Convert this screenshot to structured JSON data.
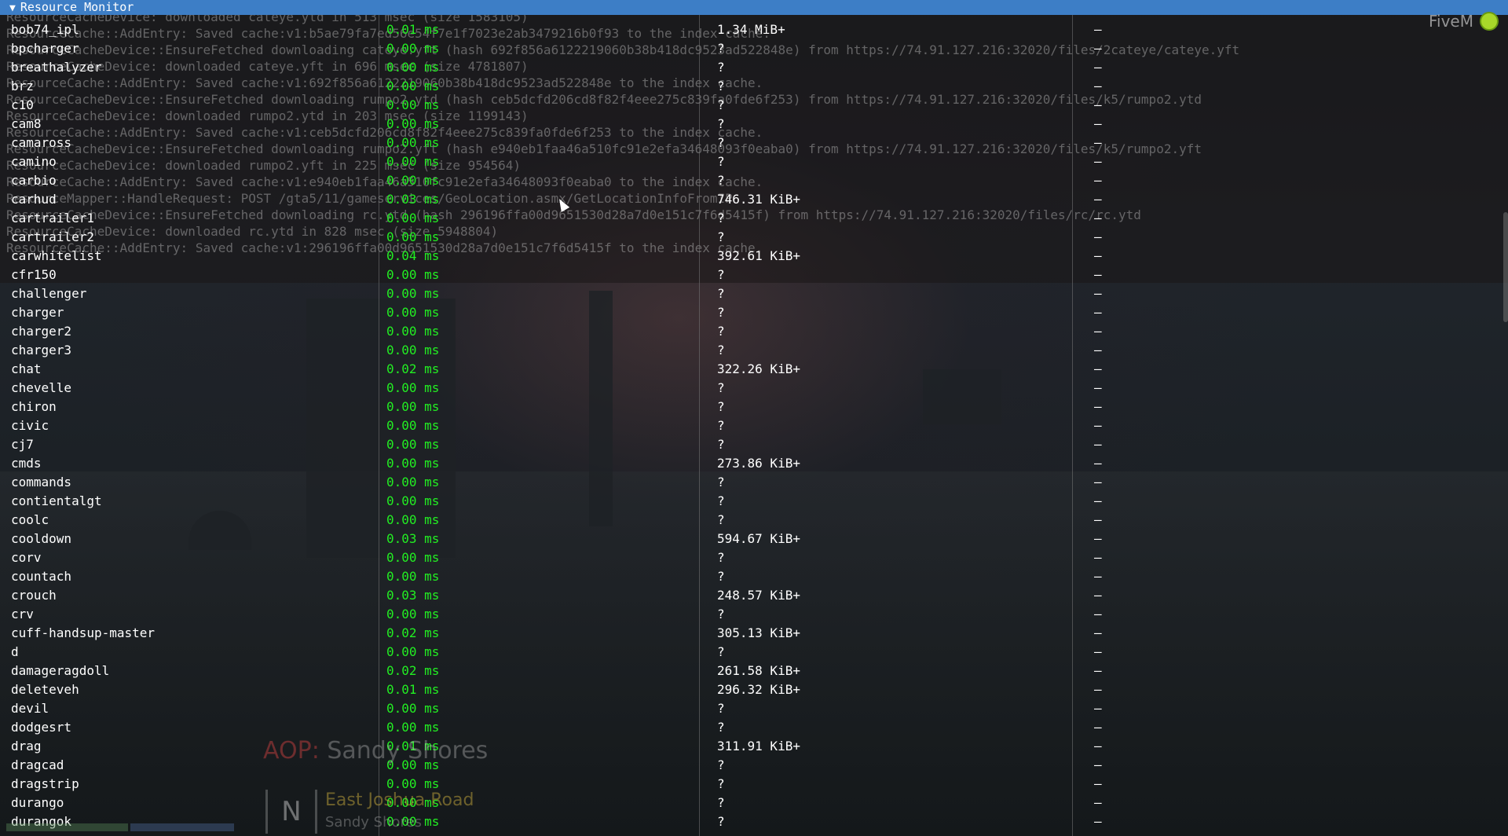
{
  "window": {
    "title": "Resource Monitor",
    "collapse_arrow": "▼"
  },
  "branding": {
    "logo_text": "FiveM",
    "logo_icon": "fivem-logo-icon"
  },
  "console_log": [
    "ResourceCacheDevice: downloaded cateye.ytd in 513 msec (size 1583105)",
    "ResourceCache::AddEntry: Saved cache:v1:b5ae79fa7ed56e54f7e1f7023e2ab3479216b0f93 to the index cache.",
    "ResourceCacheDevice::EnsureFetched downloading cateye.yft (hash 692f856a6122219060b38b418dc9523ad522848e) from https://74.91.127.216:32020/files/2cateye/cateye.yft",
    "ResourceCacheDevice: downloaded cateye.yft in 696 msec (size 4781807)",
    "ResourceCache::AddEntry: Saved cache:v1:692f856a6122219060b38b418dc9523ad522848e to the index cache.",
    "ResourceCacheDevice::EnsureFetched downloading rumpo2.ytd (hash ceb5dcfd206cd8f82f4eee275c839fa0fde6f253) from https://74.91.127.216:32020/files/k5/rumpo2.ytd",
    "ResourceCacheDevice: downloaded rumpo2.ytd in 203 msec (size 1199143)",
    "ResourceCache::AddEntry: Saved cache:v1:ceb5dcfd206cd8f82f4eee275c839fa0fde6f253 to the index cache.",
    "ResourceCacheDevice::EnsureFetched downloading rumpo2.yft (hash e940eb1faa46a510fc91e2efa34648093f0eaba0) from https://74.91.127.216:32020/files/k5/rumpo2.yft",
    "ResourceCacheDevice: downloaded rumpo2.yft in 225 msec (size 954564)",
    "ResourceCache::AddEntry: Saved cache:v1:e940eb1faa46a510fc91e2efa34648093f0eaba0 to the index cache.",
    "ResourceMapper::HandleRequest: POST /gta5/11/gameservices/GeoLocation.asmx/GetLocationInfoFromIP",
    "ResourceCacheDevice::EnsureFetched downloading rc.ytd (hash 296196ffa00d9651530d28a7d0e151c7f6d5415f) from https://74.91.127.216:32020/files/rc/rc.ytd",
    "ResourceCacheDevice: downloaded rc.ytd in 828 msec (size 5948804)",
    "ResourceCache::AddEntry: Saved cache:v1:296196ffa00d9651530d28a7d0e151c7f6d5415f to the index cache."
  ],
  "resources": [
    {
      "name": "bob74_ipl",
      "cpu": "0.01 ms",
      "memory": "1.34 MiB+",
      "extra": "–"
    },
    {
      "name": "bpcharger",
      "cpu": "0.00 ms",
      "memory": "?",
      "extra": "–"
    },
    {
      "name": "breathalyzer",
      "cpu": "0.00 ms",
      "memory": "?",
      "extra": "–"
    },
    {
      "name": "brz",
      "cpu": "0.00 ms",
      "memory": "?",
      "extra": "–"
    },
    {
      "name": "c10",
      "cpu": "0.00 ms",
      "memory": "?",
      "extra": "–"
    },
    {
      "name": "cam8",
      "cpu": "0.00 ms",
      "memory": "?",
      "extra": "–"
    },
    {
      "name": "camaross",
      "cpu": "0.00 ms",
      "memory": "?",
      "extra": "–"
    },
    {
      "name": "camino",
      "cpu": "0.00 ms",
      "memory": "?",
      "extra": "–"
    },
    {
      "name": "carbio",
      "cpu": "0.00 ms",
      "memory": "?",
      "extra": "–"
    },
    {
      "name": "carhud",
      "cpu": "0.03 ms",
      "memory": "746.31 KiB+",
      "extra": "–"
    },
    {
      "name": "cartrailer1",
      "cpu": "0.00 ms",
      "memory": "?",
      "extra": "–"
    },
    {
      "name": "cartrailer2",
      "cpu": "0.00 ms",
      "memory": "?",
      "extra": "–"
    },
    {
      "name": "carwhitelist",
      "cpu": "0.04 ms",
      "memory": "392.61 KiB+",
      "extra": "–"
    },
    {
      "name": "cfr150",
      "cpu": "0.00 ms",
      "memory": "?",
      "extra": "–"
    },
    {
      "name": "challenger",
      "cpu": "0.00 ms",
      "memory": "?",
      "extra": "–"
    },
    {
      "name": "charger",
      "cpu": "0.00 ms",
      "memory": "?",
      "extra": "–"
    },
    {
      "name": "charger2",
      "cpu": "0.00 ms",
      "memory": "?",
      "extra": "–"
    },
    {
      "name": "charger3",
      "cpu": "0.00 ms",
      "memory": "?",
      "extra": "–"
    },
    {
      "name": "chat",
      "cpu": "0.02 ms",
      "memory": "322.26 KiB+",
      "extra": "–"
    },
    {
      "name": "chevelle",
      "cpu": "0.00 ms",
      "memory": "?",
      "extra": "–"
    },
    {
      "name": "chiron",
      "cpu": "0.00 ms",
      "memory": "?",
      "extra": "–"
    },
    {
      "name": "civic",
      "cpu": "0.00 ms",
      "memory": "?",
      "extra": "–"
    },
    {
      "name": "cj7",
      "cpu": "0.00 ms",
      "memory": "?",
      "extra": "–"
    },
    {
      "name": "cmds",
      "cpu": "0.00 ms",
      "memory": "273.86 KiB+",
      "extra": "–"
    },
    {
      "name": "commands",
      "cpu": "0.00 ms",
      "memory": "?",
      "extra": "–"
    },
    {
      "name": "contientalgt",
      "cpu": "0.00 ms",
      "memory": "?",
      "extra": "–"
    },
    {
      "name": "coolc",
      "cpu": "0.00 ms",
      "memory": "?",
      "extra": "–"
    },
    {
      "name": "cooldown",
      "cpu": "0.03 ms",
      "memory": "594.67 KiB+",
      "extra": "–"
    },
    {
      "name": "corv",
      "cpu": "0.00 ms",
      "memory": "?",
      "extra": "–"
    },
    {
      "name": "countach",
      "cpu": "0.00 ms",
      "memory": "?",
      "extra": "–"
    },
    {
      "name": "crouch",
      "cpu": "0.03 ms",
      "memory": "248.57 KiB+",
      "extra": "–"
    },
    {
      "name": "crv",
      "cpu": "0.00 ms",
      "memory": "?",
      "extra": "–"
    },
    {
      "name": "cuff-handsup-master",
      "cpu": "0.02 ms",
      "memory": "305.13 KiB+",
      "extra": "–"
    },
    {
      "name": "d",
      "cpu": "0.00 ms",
      "memory": "?",
      "extra": "–"
    },
    {
      "name": "damageragdoll",
      "cpu": "0.02 ms",
      "memory": "261.58 KiB+",
      "extra": "–"
    },
    {
      "name": "deleteveh",
      "cpu": "0.01 ms",
      "memory": "296.32 KiB+",
      "extra": "–"
    },
    {
      "name": "devil",
      "cpu": "0.00 ms",
      "memory": "?",
      "extra": "–"
    },
    {
      "name": "dodgesrt",
      "cpu": "0.00 ms",
      "memory": "?",
      "extra": "–"
    },
    {
      "name": "drag",
      "cpu": "0.01 ms",
      "memory": "311.91 KiB+",
      "extra": "–"
    },
    {
      "name": "dragcad",
      "cpu": "0.00 ms",
      "memory": "?",
      "extra": "–"
    },
    {
      "name": "dragstrip",
      "cpu": "0.00 ms",
      "memory": "?",
      "extra": "–"
    },
    {
      "name": "durango",
      "cpu": "0.00 ms",
      "memory": "?",
      "extra": "–"
    },
    {
      "name": "durangok",
      "cpu": "0.00 ms",
      "memory": "?",
      "extra": "–"
    }
  ],
  "hud": {
    "aop_label": "AOP:",
    "aop_location": "Sandy Shores",
    "compass": "N",
    "street": "East Joshua Road",
    "zone": "Sandy Shores"
  },
  "colors": {
    "titlebar": "#3d7ec6",
    "cpu_text": "#22ee22",
    "name_text": "#ffffff"
  }
}
